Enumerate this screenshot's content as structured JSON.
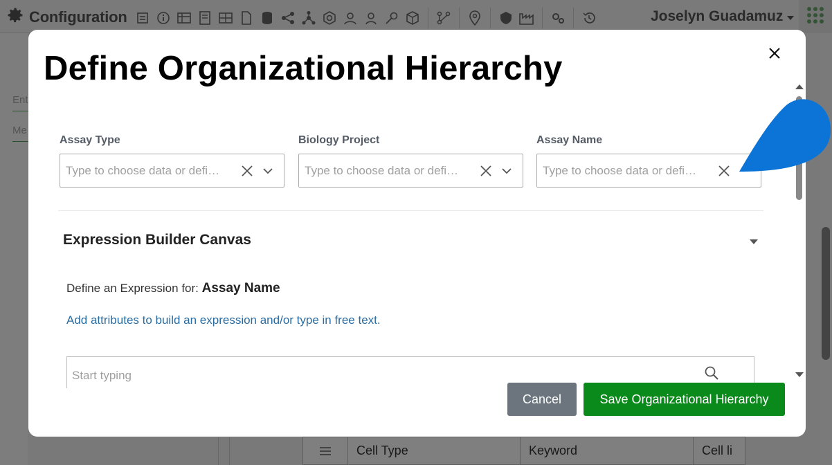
{
  "app": {
    "title": "Configuration",
    "user_name": "Joselyn Guadamuz",
    "toolbar_icons": [
      "form-icon",
      "info-icon",
      "table-icon",
      "document-icon",
      "grid-icon",
      "file-icon",
      "database-icon",
      "share-icon",
      "network-icon",
      "hexagon-icon",
      "users-icon",
      "user-icon",
      "key-icon",
      "cube-icon",
      "workflow-icon",
      "location-icon",
      "shield-icon",
      "factory-icon",
      "gears-icon",
      "history-icon"
    ],
    "left_fields": [
      "Ent",
      "Me"
    ]
  },
  "background_table": {
    "row": [
      "Cell Type",
      "Keyword",
      "Cell li"
    ]
  },
  "modal": {
    "title": "Define Organizational Hierarchy",
    "fields": [
      {
        "label": "Assay Type",
        "placeholder": "Type to choose data or defi…",
        "has_clear": true,
        "has_dropdown": true
      },
      {
        "label": "Biology Project",
        "placeholder": "Type to choose data or defi…",
        "has_clear": true,
        "has_dropdown": true
      },
      {
        "label": "Assay Name",
        "placeholder": "Type to choose data or defi…",
        "has_clear": true,
        "has_dropdown": false
      }
    ],
    "section": {
      "title": "Expression Builder Canvas",
      "expression_prefix": "Define an Expression for: ",
      "expression_target": "Assay Name",
      "hint": "Add attributes to build an expression and/or type in free text.",
      "search_placeholder": "Start typing"
    },
    "buttons": {
      "cancel": "Cancel",
      "save": "Save Organizational Hierarchy"
    }
  },
  "colors": {
    "save_button": "#0a8a1a",
    "cancel_button": "#6c757d",
    "hint_link": "#2b6ca0",
    "blob": "#0b74d6"
  }
}
